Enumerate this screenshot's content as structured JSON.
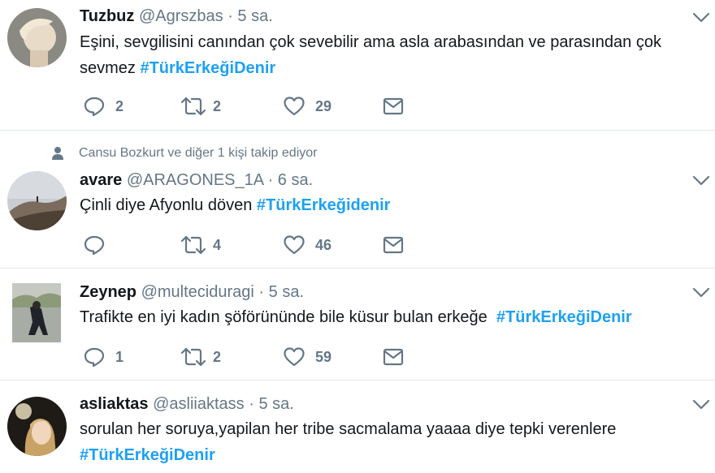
{
  "tweets": [
    {
      "name": "Tuzbuz",
      "handle": "@Agrszbas",
      "dot": "·",
      "time": "5 sa.",
      "text_line1": "Eşini, sevgilisini canından çok sevebilir ama asla arabasından ve parasından çok",
      "text_line2": "sevmez",
      "hashtag": "#TürkErkeğiDenir",
      "replies": "2",
      "retweets": "2",
      "likes": "29"
    },
    {
      "social_context": "Cansu Bozkurt ve diğer 1 kişi takip ediyor",
      "name": "avare",
      "handle": "@ARAGONES_1A",
      "dot": "·",
      "time": "6 sa.",
      "text": "Çinli diye Afyonlu döven",
      "hashtag": "#TürkErkeğidenir",
      "replies": "",
      "retweets": "4",
      "likes": "46"
    },
    {
      "name": "Zeynep",
      "handle": "@multeciduragi",
      "dot": "·",
      "time": "5 sa.",
      "text": "Trafikte en iyi kadın şöförününde bile küsur bulan erkeğe",
      "hashtag": "#TürkErkeğiDenir",
      "replies": "1",
      "retweets": "2",
      "likes": "59"
    },
    {
      "name": "asliaktas",
      "handle": "@asliiaktass",
      "dot": "·",
      "time": "5 sa.",
      "text": "sorulan her soruya,yapilan her tribe sacmalama yaaaa diye tepki verenlere",
      "hashtag": "#TürkErkeğiDenir"
    }
  ],
  "colors": {
    "hashtag": "#1da1f2",
    "secondary_text": "#657786",
    "divider": "#e1e8ed"
  },
  "icons": [
    "reply-icon",
    "retweet-icon",
    "like-icon",
    "direct-message-icon",
    "chevron-down-icon",
    "person-icon"
  ]
}
